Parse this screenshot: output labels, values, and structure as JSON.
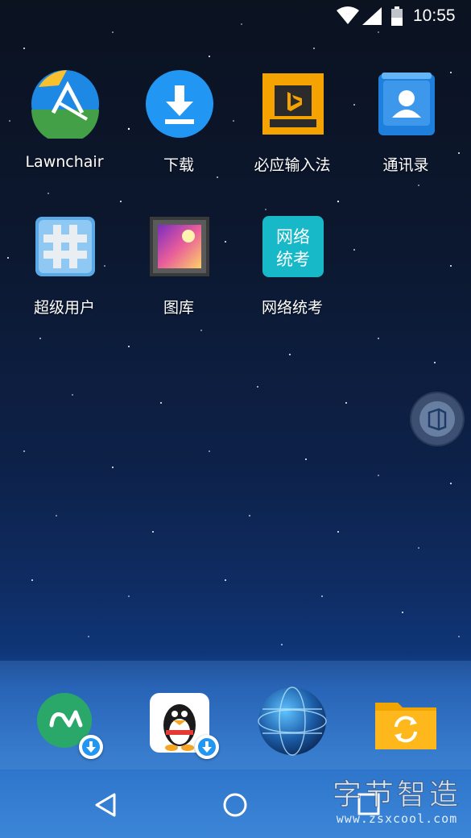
{
  "status_bar": {
    "time": "10:55",
    "icons": [
      "wifi-icon",
      "cell-signal-icon",
      "battery-icon"
    ]
  },
  "apps": [
    {
      "id": "lawnchair",
      "label": "Lawnchair",
      "icon": "lawnchair-icon"
    },
    {
      "id": "download",
      "label": "下载",
      "icon": "download-icon"
    },
    {
      "id": "bing-input",
      "label": "必应输入法",
      "icon": "bing-keyboard-icon"
    },
    {
      "id": "contacts",
      "label": "通讯录",
      "icon": "contacts-icon"
    },
    {
      "id": "superuser",
      "label": "超级用户",
      "icon": "superuser-hash-icon"
    },
    {
      "id": "gallery",
      "label": "图库",
      "icon": "gallery-icon"
    },
    {
      "id": "wangluo",
      "label": "网络统考",
      "icon": "wangluo-tongkao-icon",
      "icon_text": [
        "网络",
        "统考"
      ]
    }
  ],
  "dock": [
    {
      "id": "app-store",
      "icon": "app-store-icon",
      "downloading": true
    },
    {
      "id": "qq",
      "icon": "qq-penguin-icon",
      "downloading": true
    },
    {
      "id": "browser",
      "icon": "globe-browser-icon",
      "downloading": false
    },
    {
      "id": "file-sync",
      "icon": "folder-sync-icon",
      "downloading": false
    }
  ],
  "nav_bar": [
    "back-icon",
    "home-icon",
    "recents-icon"
  ],
  "watermark": {
    "title": "字节智造",
    "url": "www.zsxcool.com"
  },
  "colors": {
    "download_blue": "#2196f3",
    "bing_orange": "#f5a300",
    "contacts_blue": "#1f7fdc",
    "wangluo_cyan": "#17b9c9"
  }
}
